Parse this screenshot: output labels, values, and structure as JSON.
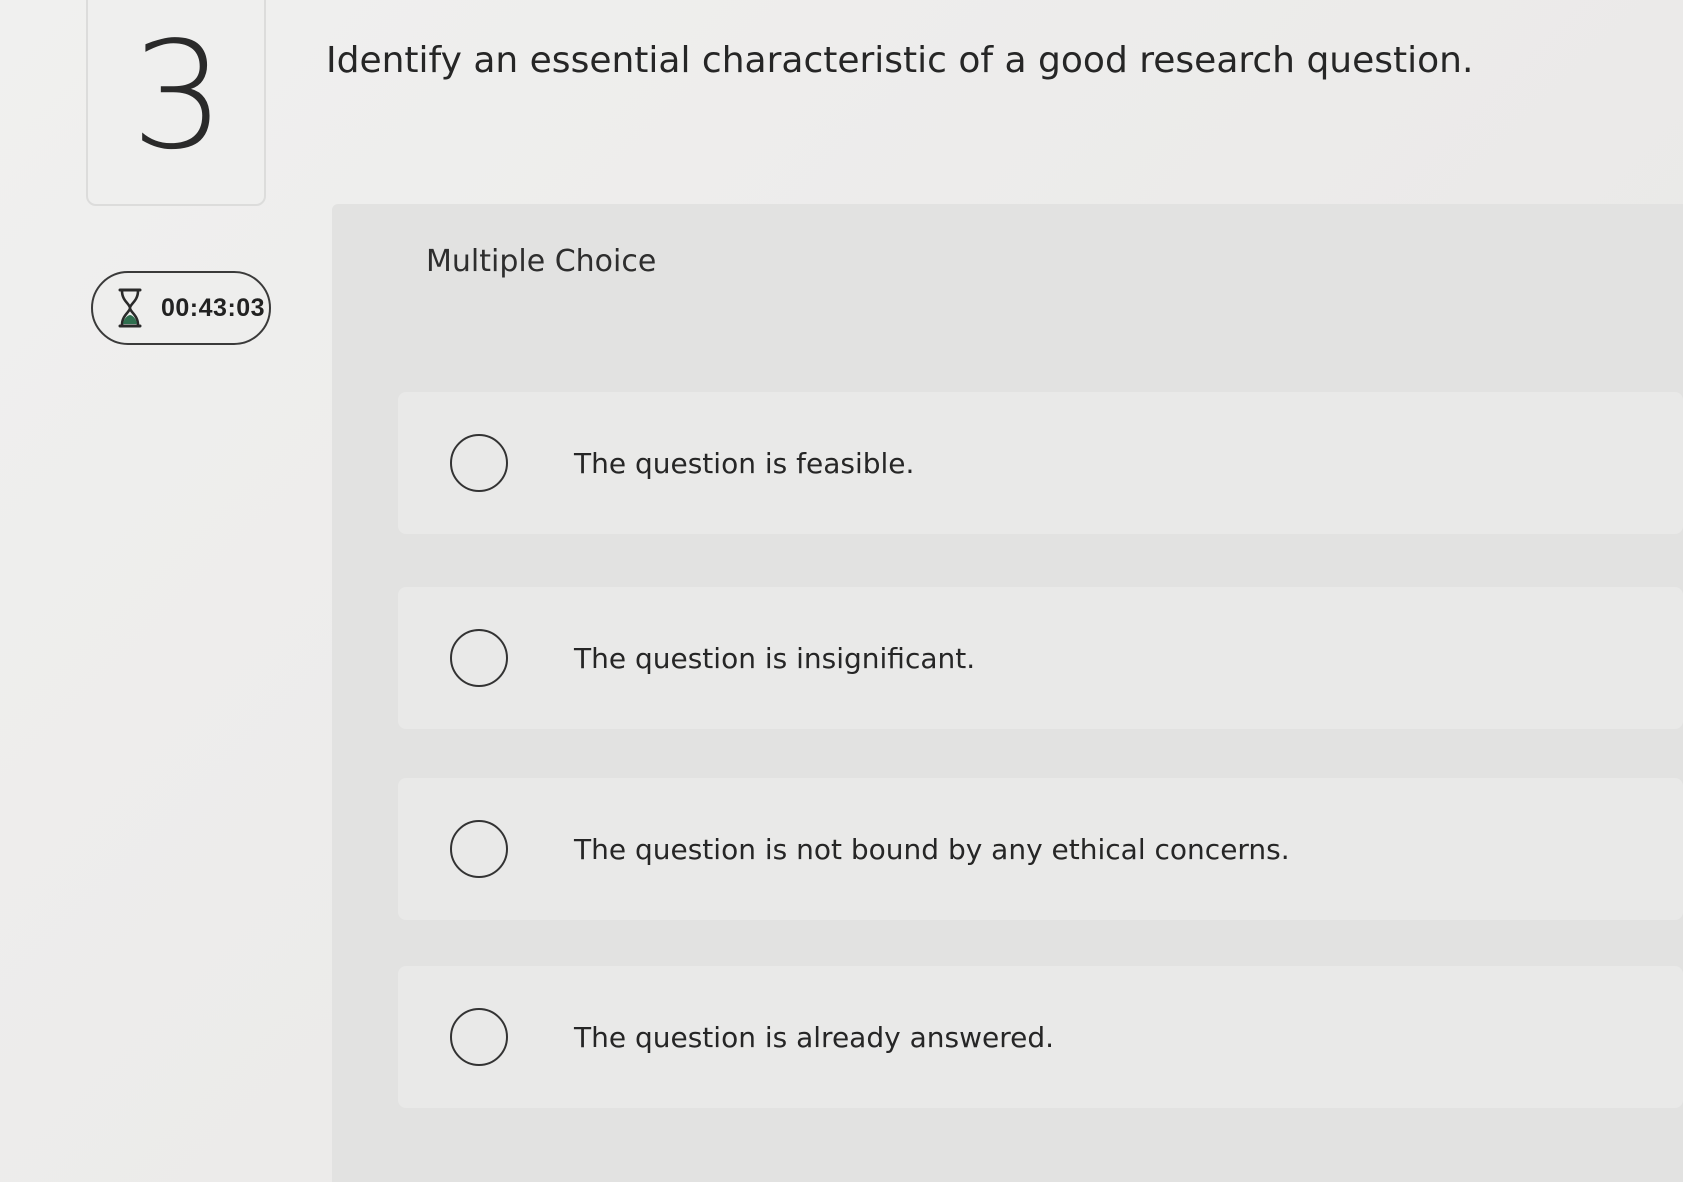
{
  "question": {
    "number": "3",
    "prompt": "Identify an essential characteristic of a good research question."
  },
  "timer": {
    "icon": "hourglass-icon",
    "value": "00:43:03"
  },
  "answer_section": {
    "type_label": "Multiple Choice",
    "options": [
      {
        "label": "The question is feasible."
      },
      {
        "label": "The question is insignificant."
      },
      {
        "label": "The question is not bound by any ethical concerns."
      },
      {
        "label": "The question is already answered."
      }
    ]
  }
}
